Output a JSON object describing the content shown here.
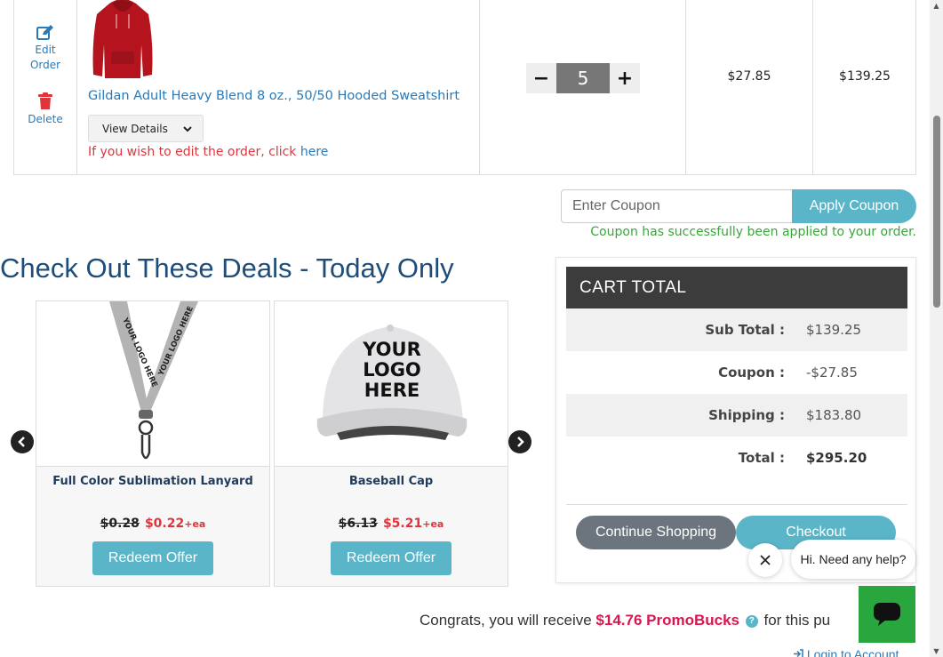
{
  "cart_item": {
    "edit_label_1": "Edit",
    "edit_label_2": "Order",
    "delete_label": "Delete",
    "product_name": "Gildan Adult Heavy Blend 8 oz., 50/50 Hooded Sweatshirt",
    "view_details_label": "View Details",
    "edit_note": "If you wish to edit the order, click ",
    "edit_note_link": "here",
    "quantity": "5",
    "qty_minus": "−",
    "qty_plus": "+",
    "unit_price": "$27.85",
    "line_total": "$139.25",
    "product_color": "#b5141f"
  },
  "coupon": {
    "placeholder": "Enter Coupon",
    "apply_label": "Apply Coupon",
    "success_message": "Coupon has successfully been applied to your order."
  },
  "deals": {
    "title": "Check Out These Deals - Today Only",
    "items": [
      {
        "name": "Full Color Sublimation Lanyard",
        "old_price": "$0.28",
        "new_price": "$0.22",
        "unit": "+ea",
        "button": "Redeem Offer",
        "image_text": "YOUR LOGO HERE"
      },
      {
        "name": "Baseball Cap",
        "old_price": "$6.13",
        "new_price": "$5.21",
        "unit": "+ea",
        "button": "Redeem Offer",
        "image_text_1": "YOUR",
        "image_text_2": "LOGO",
        "image_text_3": "HERE"
      }
    ]
  },
  "cart_total": {
    "title": "CART  TOTAL",
    "rows": [
      {
        "label": "Sub Total :",
        "value": "$139.25"
      },
      {
        "label": "Coupon :",
        "value": "-$27.85"
      },
      {
        "label": "Shipping :",
        "value": "$183.80"
      },
      {
        "label": "Total :",
        "value": "$295.20"
      }
    ],
    "continue_label": "Continue Shopping",
    "checkout_label": "Checkout"
  },
  "chat": {
    "greeting": "Hi. Need any help?"
  },
  "promo": {
    "prefix": "Congrats, you will receive ",
    "amount": "$14.76 PromoBucks",
    "suffix": " for this pu"
  },
  "login_link": "Login to Account",
  "colors": {
    "accent": "#5bb5c8",
    "link": "#2a7ab8",
    "sale_red": "#e0343c",
    "title_blue": "#1f4d7a",
    "promo_pink": "#d6184f",
    "chat_green": "#2aa63e",
    "success_green": "#3aa53a"
  }
}
